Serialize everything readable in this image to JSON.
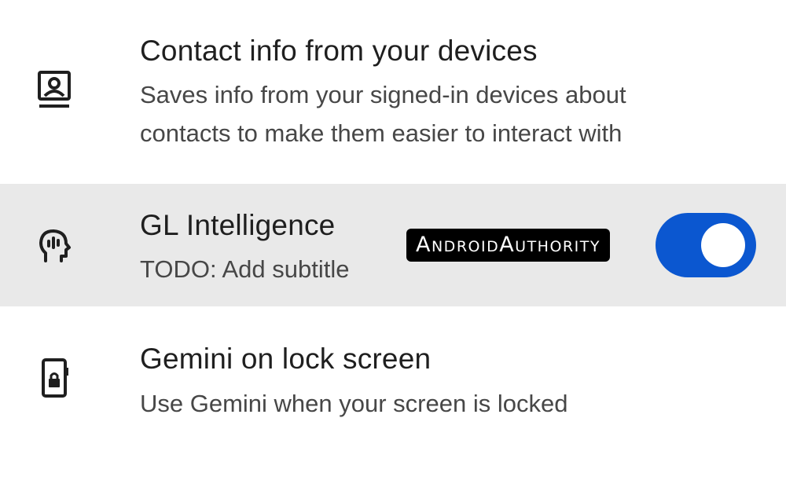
{
  "settings": {
    "items": [
      {
        "icon": "contact-card-icon",
        "title": "Contact info from your devices",
        "subtitle_line1": "Saves info from your signed-in devices about",
        "subtitle_line2": "contacts to make them easier to interact with"
      },
      {
        "icon": "head-intelligence-icon",
        "title": "GL Intelligence",
        "subtitle": "TODO: Add subtitle",
        "toggle_on": true,
        "highlighted": true
      },
      {
        "icon": "phone-lock-icon",
        "title": "Gemini on lock screen",
        "subtitle": "Use Gemini when your screen is locked"
      }
    ]
  },
  "watermark": "AndroidAuthority",
  "colors": {
    "toggle_track": "#0b57d0",
    "toggle_thumb": "#ffffff",
    "highlight_bg": "#e9e9e9",
    "title_text": "#1f1f1f",
    "subtitle_text": "#474747"
  }
}
